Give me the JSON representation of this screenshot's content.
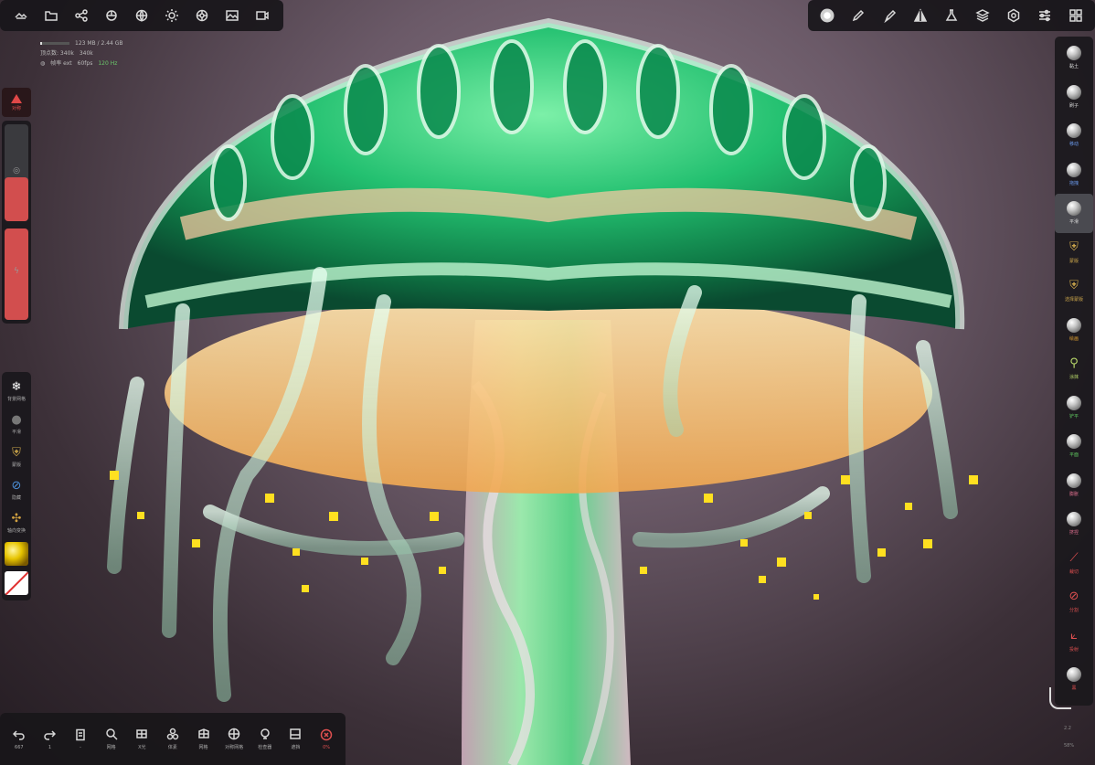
{
  "colors": {
    "accent_red": "#d24e4e",
    "panel_bg": "#1a181c",
    "fps_good": "#6ac76a",
    "icon": "#d8d8d8"
  },
  "top_left_toolbar": [
    {
      "icon": "gallery-icon"
    },
    {
      "icon": "folder-icon"
    },
    {
      "icon": "share-nodes-icon"
    },
    {
      "icon": "scene-icon"
    },
    {
      "icon": "globe-icon"
    },
    {
      "icon": "sun-icon"
    },
    {
      "icon": "gear-wheel-icon"
    },
    {
      "icon": "image-icon"
    },
    {
      "icon": "video-icon"
    }
  ],
  "top_right_toolbar": [
    {
      "icon": "brush-preview-icon"
    },
    {
      "icon": "pencil-icon"
    },
    {
      "icon": "paint-icon"
    },
    {
      "icon": "symmetry-icon"
    },
    {
      "icon": "flask-icon"
    },
    {
      "icon": "layers-icon"
    },
    {
      "icon": "settings-icon"
    },
    {
      "icon": "sliders-icon"
    },
    {
      "icon": "grid-icon"
    }
  ],
  "stats": {
    "memory": "123 MB / 2.44 GB",
    "memory_fraction": 0.05,
    "vertices": "顶点数: 340k",
    "faces": "340k",
    "fps_label": "帧率 ext",
    "fps_value": "60fps",
    "fps_extra": "120 Hz"
  },
  "left_warning": {
    "label": "对称"
  },
  "sliders": {
    "radius_fraction": 0.45,
    "intensity_fraction": 1.0,
    "radius_glyph": "◎",
    "intensity_glyph": "ϟ"
  },
  "left_tools": [
    {
      "label": "背景网格",
      "glyph": "❄",
      "color": "#ffffff"
    },
    {
      "label": "平滑",
      "glyph": "●",
      "color": "#777777"
    },
    {
      "label": "蒙版",
      "glyph": "⛨",
      "color": "#c9a44a"
    },
    {
      "label": "隐藏",
      "glyph": "⊘",
      "color": "#4a8fd8"
    },
    {
      "label": "轴向变换",
      "glyph": "✣",
      "color": "#d0a040"
    }
  ],
  "right_brushes": [
    {
      "label": "黏土",
      "type": "sphere",
      "color": "#dddddd"
    },
    {
      "label": "刷子",
      "type": "sphere",
      "color": "#dddddd"
    },
    {
      "label": "移动",
      "type": "sphere",
      "color": "#6c9cf0"
    },
    {
      "label": "拖拽",
      "type": "sphere",
      "color": "#6c9cf0"
    },
    {
      "label": "平滑",
      "type": "sphere",
      "color": "#dddddd",
      "active": true
    },
    {
      "label": "蒙版",
      "type": "icon",
      "glyph": "⛨",
      "color": "#c9a44a"
    },
    {
      "label": "选择蒙版",
      "type": "icon",
      "glyph": "⛨",
      "color": "#c9a44a"
    },
    {
      "label": "绘画",
      "type": "sphere",
      "color": "#e0a030"
    },
    {
      "label": "涂抹",
      "type": "icon",
      "glyph": "⚲",
      "color": "#b8d86a"
    },
    {
      "label": "铲平",
      "type": "sphere",
      "color": "#60c860"
    },
    {
      "label": "平面",
      "type": "sphere",
      "color": "#60c860"
    },
    {
      "label": "膨胀",
      "type": "sphere",
      "color": "#e07090"
    },
    {
      "label": "挤捏",
      "type": "sphere",
      "color": "#e07090"
    },
    {
      "label": "裁切",
      "type": "icon",
      "glyph": "⟋",
      "color": "#e05050"
    },
    {
      "label": "分割",
      "type": "icon",
      "glyph": "⊘",
      "color": "#e05050"
    },
    {
      "label": "投射",
      "type": "icon",
      "glyph": "⟀",
      "color": "#e05050"
    },
    {
      "label": "黑",
      "type": "sphere",
      "color": "#e05050"
    }
  ],
  "bottom_right": {
    "value_top": "2.2",
    "value_bottom": "58%"
  },
  "bottom_toolbar": [
    {
      "label": "667",
      "icon": "undo-icon"
    },
    {
      "label": "1",
      "icon": "redo-icon"
    },
    {
      "label": "-",
      "icon": "document-icon"
    },
    {
      "label": "网格",
      "icon": "search-icon"
    },
    {
      "label": "X光",
      "icon": "xray-icon"
    },
    {
      "label": "体素",
      "icon": "voxel-icon"
    },
    {
      "label": "网格",
      "icon": "mesh-icon"
    },
    {
      "label": "对称网格",
      "icon": "sym-mesh-icon"
    },
    {
      "label": "检查器",
      "icon": "inspector-icon"
    },
    {
      "label": "遮挡",
      "icon": "occlusion-icon"
    },
    {
      "label": "0%",
      "icon": "close-circle-icon"
    }
  ]
}
